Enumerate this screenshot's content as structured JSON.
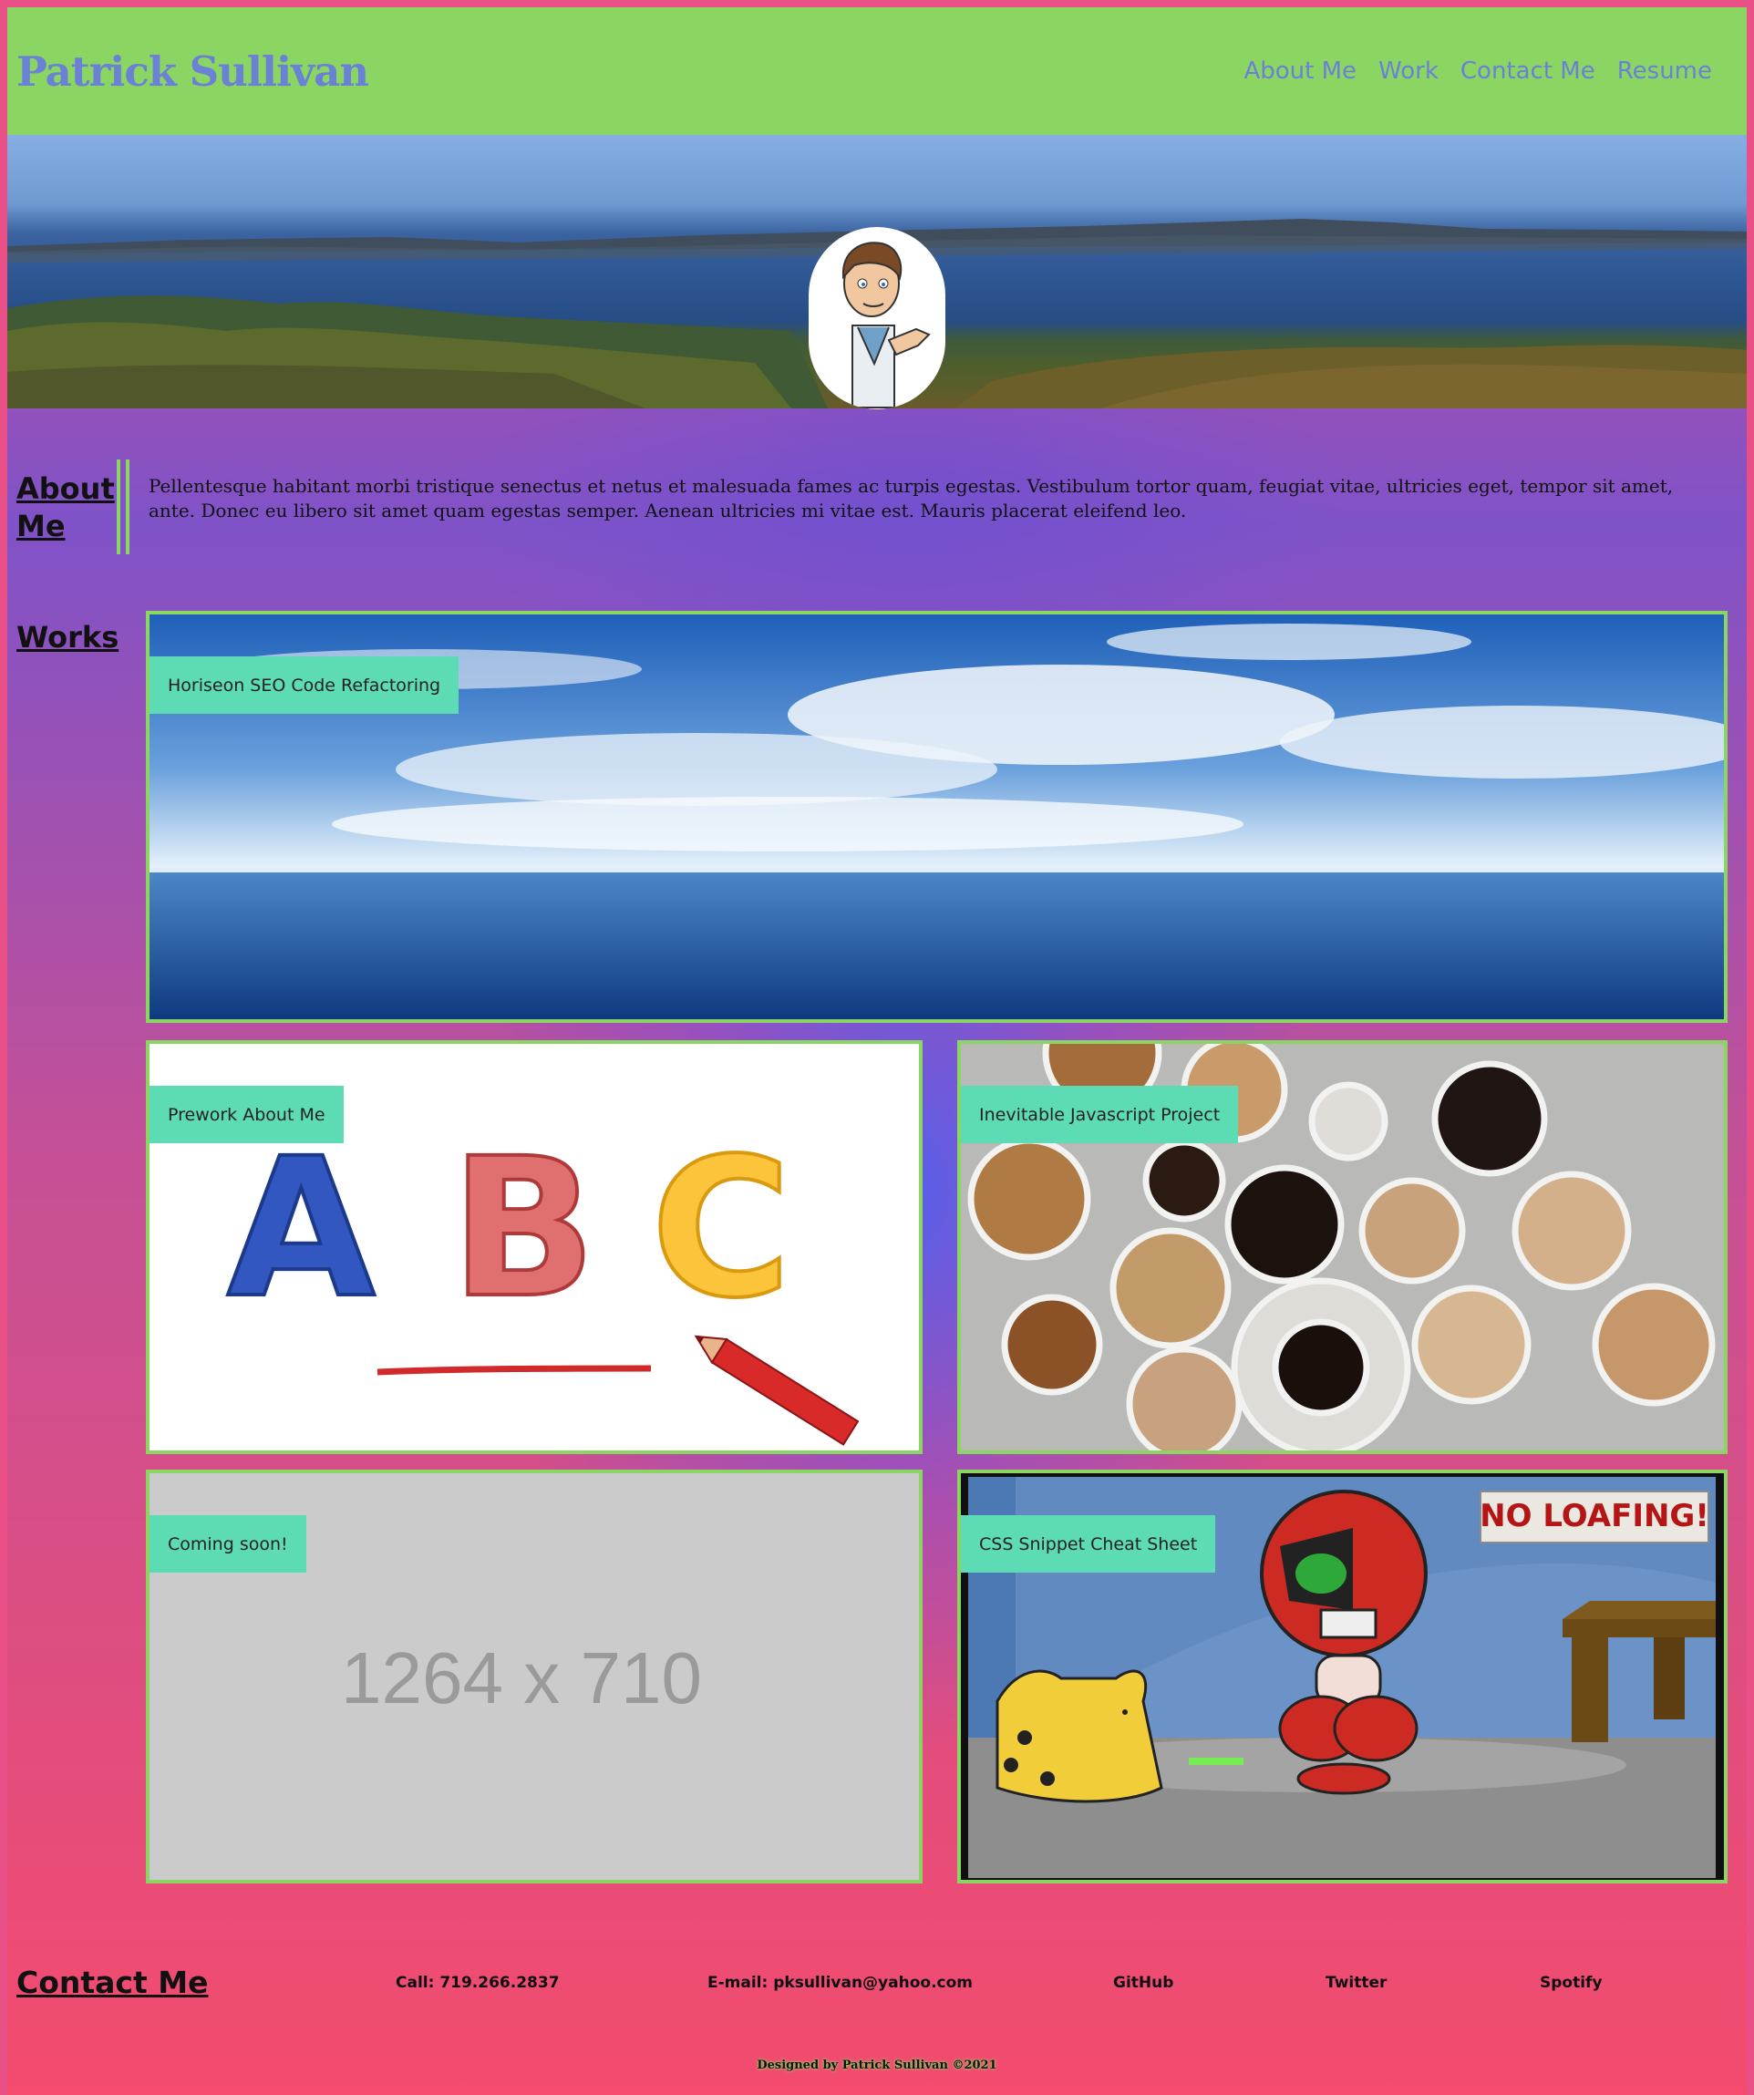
{
  "header": {
    "site_title": "Patrick Sullivan",
    "nav": [
      "About Me",
      "Work",
      "Contact Me",
      "Resume"
    ]
  },
  "about": {
    "heading": "About Me",
    "text": "Pellentesque habitant morbi tristique senectus et netus et malesuada fames ac turpis egestas. Vestibulum tortor quam, feugiat vitae, ultricies eget, tempor sit amet, ante. Donec eu libero sit amet quam egestas semper. Aenean ultricies mi vitae est. Mauris placerat eleifend leo."
  },
  "works": {
    "heading": "Works",
    "cards": [
      {
        "label": "Horiseon SEO Code Refactoring"
      },
      {
        "label": "Prework About Me"
      },
      {
        "label": "Inevitable Javascript Project"
      },
      {
        "label": "Coming soon!",
        "placeholder_text": "1264 x 710"
      },
      {
        "label": "CSS Snippet Cheat Sheet",
        "sign_text": "NO LOAFING!"
      }
    ]
  },
  "abc_letters": [
    "A",
    "B",
    "C"
  ],
  "contact": {
    "heading": "Contact Me",
    "items": [
      "Call: 719.266.2837",
      "E-mail: pksullivan@yahoo.com",
      "GitHub",
      "Twitter",
      "Spotify"
    ]
  },
  "footer": {
    "credit": "Designed by Patrick Sullivan ©2021"
  },
  "colors": {
    "header_bg": "#8bd662",
    "title_text": "#6a81d6",
    "card_tag_bg": "#5ddbb5",
    "card_border": "#8bd662"
  }
}
